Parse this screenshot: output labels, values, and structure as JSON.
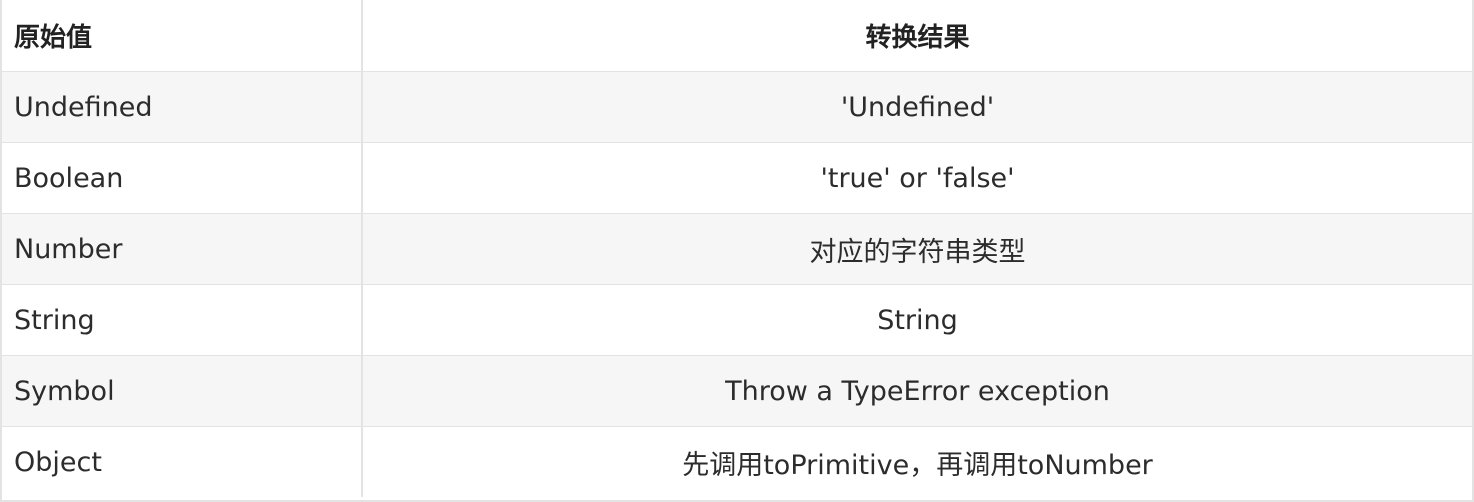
{
  "table": {
    "headers": {
      "original": "原始值",
      "result": "转换结果"
    },
    "rows": [
      {
        "original": "Undefined",
        "result": "'Undefined'"
      },
      {
        "original": "Boolean",
        "result": "'true' or 'false'"
      },
      {
        "original": "Number",
        "result": "对应的字符串类型"
      },
      {
        "original": "String",
        "result": "String"
      },
      {
        "original": "Symbol",
        "result": "Throw a TypeError exception"
      },
      {
        "original": "Object",
        "result": "先调用toPrimitive，再调用toNumber"
      }
    ]
  }
}
